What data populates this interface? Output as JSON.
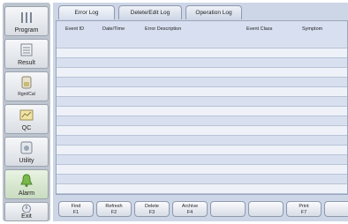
{
  "sidebar": {
    "items": [
      {
        "label": "Program",
        "icon": "program-icon"
      },
      {
        "label": "Result",
        "icon": "result-icon"
      },
      {
        "label": "Rgnt/Cal",
        "icon": "reagent-calibration-icon"
      },
      {
        "label": "QC",
        "icon": "qc-icon"
      },
      {
        "label": "Utility",
        "icon": "utility-icon"
      },
      {
        "label": "Alarm",
        "icon": "alarm-bell-icon",
        "active": true
      },
      {
        "label": "Exit",
        "icon": "exit-icon"
      }
    ]
  },
  "tabs": [
    {
      "label": "Error Log",
      "active": true
    },
    {
      "label": "Delete/Edit Log"
    },
    {
      "label": "Operation Log"
    }
  ],
  "table": {
    "columns": [
      "Event ID",
      "Date/Time",
      "Error Description",
      "Event Class",
      "Symptom"
    ]
  },
  "function_buttons": [
    {
      "label": "Find",
      "key": "F1"
    },
    {
      "label": "Refresh",
      "key": "F2"
    },
    {
      "label": "Delete",
      "key": "F3"
    },
    {
      "label": "Archive",
      "key": "F4"
    },
    {
      "label": "",
      "key": ""
    },
    {
      "label": "",
      "key": ""
    },
    {
      "label": "Print",
      "key": "F7"
    },
    {
      "label": "",
      "key": ""
    }
  ],
  "colors": {
    "sidebar_bg": "#bcc4cf",
    "main_bg": "#cdd6e6",
    "row_even": "#d8e0f0",
    "row_odd": "#eef2f8",
    "alarm_active": "#7ab84a"
  }
}
